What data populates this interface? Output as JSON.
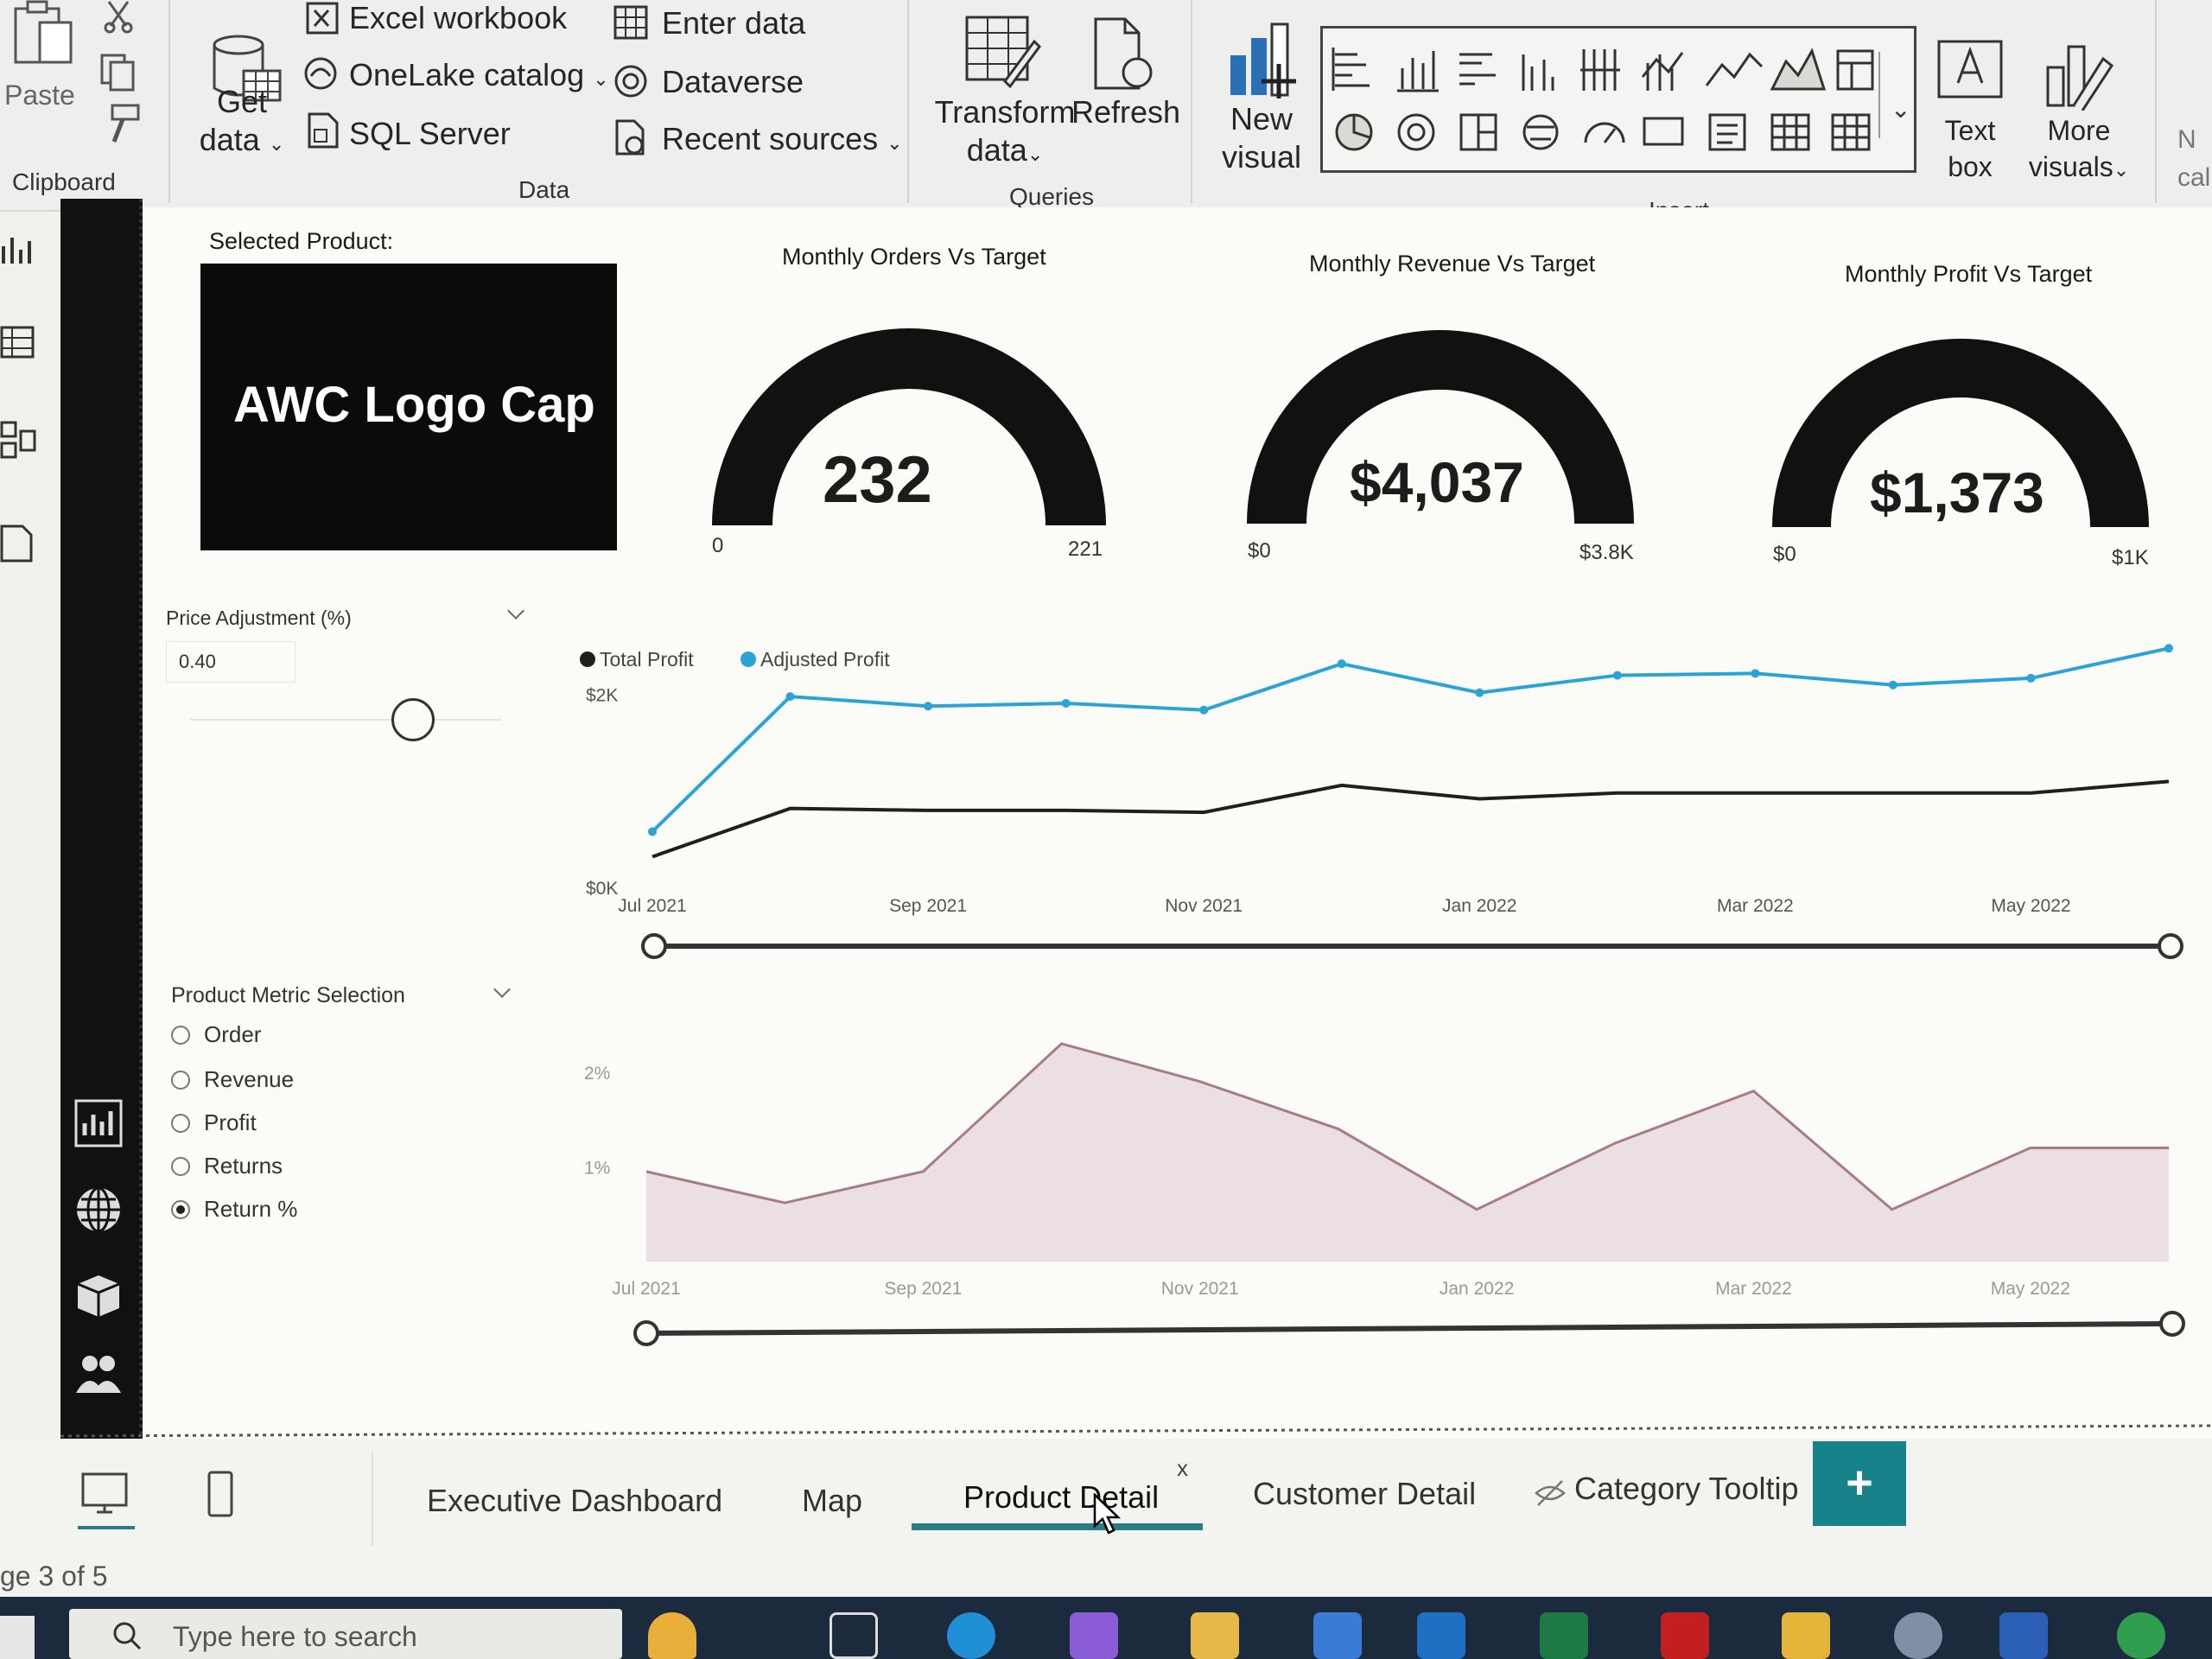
{
  "ribbon": {
    "clipboard": {
      "paste": "Paste",
      "group_label": "Clipboard"
    },
    "data": {
      "get_data": [
        "Get",
        "data"
      ],
      "excel_workbook": "Excel workbook",
      "onelake_catalog": "OneLake catalog",
      "sql_server": "SQL Server",
      "enter_data": "Enter data",
      "dataverse": "Dataverse",
      "recent_sources": "Recent sources",
      "group_label": "Data"
    },
    "queries": {
      "transform_data": [
        "Transform",
        "data"
      ],
      "refresh": "Refresh",
      "group_label": "Queries"
    },
    "insert": {
      "new_visual": [
        "New",
        "visual"
      ],
      "text_box": [
        "Text",
        "box"
      ],
      "more_visuals": [
        "More",
        "visuals"
      ],
      "group_label": "Insert",
      "cut_off": [
        "N",
        "cal"
      ]
    }
  },
  "report": {
    "selected_product": {
      "title": "Selected Product:",
      "value": "AWC Logo Cap"
    },
    "gauges": [
      {
        "title": "Monthly Orders Vs Target",
        "value": "232",
        "min": "0",
        "max": "221",
        "fraction": 1.0
      },
      {
        "title": "Monthly Revenue Vs Target",
        "value": "$4,037",
        "min": "$0",
        "max": "$3.8K",
        "fraction": 1.0
      },
      {
        "title": "Monthly Profit Vs Target",
        "value": "$1,373",
        "min": "$0",
        "max": "$1K",
        "fraction": 1.0
      }
    ],
    "price_adjustment": {
      "title": "Price Adjustment (%)",
      "value": "0.40"
    },
    "metric_selection": {
      "title": "Product Metric Selection",
      "options": [
        "Order",
        "Revenue",
        "Profit",
        "Returns",
        "Return %"
      ],
      "selected": "Return %"
    }
  },
  "chart_data": [
    {
      "type": "line",
      "x": [
        "Jul 2021",
        "Aug 2021",
        "Sep 2021",
        "Oct 2021",
        "Nov 2021",
        "Dec 2021",
        "Jan 2022",
        "Feb 2022",
        "Mar 2022",
        "Apr 2022",
        "May 2022",
        "Jun 2022"
      ],
      "x_ticks": [
        "Jul 2021",
        "Sep 2021",
        "Nov 2021",
        "Jan 2022",
        "Mar 2022",
        "May 2022"
      ],
      "y_ticks": [
        "$0K",
        "$2K"
      ],
      "ylim": [
        0,
        3000
      ],
      "legend_position": "top-left",
      "series": [
        {
          "name": "Total Profit",
          "color": "#1f1f1f",
          "values": [
            300,
            800,
            780,
            780,
            760,
            1040,
            900,
            960,
            960,
            960,
            960,
            1080
          ]
        },
        {
          "name": "Adjusted Profit",
          "color": "#2aa3d6",
          "values": [
            560,
            1960,
            1860,
            1890,
            1820,
            2300,
            2000,
            2180,
            2200,
            2080,
            2150,
            2460
          ]
        }
      ]
    },
    {
      "type": "area",
      "x": [
        "Jul 2021",
        "Aug 2021",
        "Sep 2021",
        "Oct 2021",
        "Nov 2021",
        "Dec 2021",
        "Jan 2022",
        "Feb 2022",
        "Mar 2022",
        "Apr 2022",
        "May 2022",
        "Jun 2022"
      ],
      "x_ticks": [
        "Jul 2021",
        "Sep 2021",
        "Nov 2021",
        "Jan 2022",
        "Mar 2022",
        "May 2022"
      ],
      "y_ticks": [
        "1%",
        "2%"
      ],
      "ylim": [
        0,
        2.6
      ],
      "series": [
        {
          "name": "Return %",
          "color": "#a87b8a",
          "values": [
            0.95,
            0.62,
            0.95,
            2.3,
            1.9,
            1.4,
            0.55,
            1.25,
            1.8,
            0.55,
            1.2,
            1.2
          ]
        }
      ]
    }
  ],
  "tabs": {
    "items": [
      "Executive Dashboard",
      "Map",
      "Product Detail",
      "Customer Detail",
      "Category Tooltip"
    ],
    "active": "Product Detail",
    "close": "x",
    "add": "+",
    "page_count": "ge 3 of 5"
  },
  "taskbar": {
    "search_placeholder": "Type here to search"
  }
}
